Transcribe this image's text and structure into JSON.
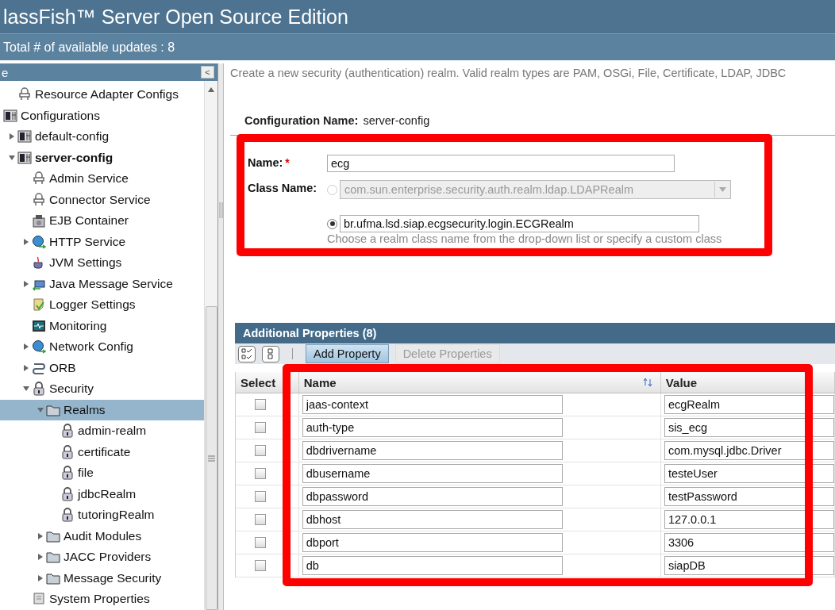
{
  "header": {
    "title": "lassFish™ Server Open Source Edition",
    "updates": "Total # of available updates : 8"
  },
  "sidebar": {
    "title": "e",
    "collapse": "<",
    "tree": [
      {
        "children": [
          {
            "label": "Resource Adapter Configs",
            "kind": "service"
          }
        ]
      },
      {
        "label": "Configurations",
        "kind": "config",
        "children": [
          {
            "label": "default-config",
            "kind": "config",
            "expanded": false
          },
          {
            "label": "server-config",
            "kind": "config",
            "expanded": true,
            "bold": true,
            "children": [
              {
                "label": "Admin Service",
                "kind": "service"
              },
              {
                "label": "Connector Service",
                "kind": "service"
              },
              {
                "label": "EJB Container",
                "kind": "container"
              },
              {
                "label": "HTTP Service",
                "kind": "network",
                "expanded": false
              },
              {
                "label": "JVM Settings",
                "kind": "jvm"
              },
              {
                "label": "Java Message Service",
                "kind": "messaging",
                "expanded": false
              },
              {
                "label": "Logger Settings",
                "kind": "logger"
              },
              {
                "label": "Monitoring",
                "kind": "monitor"
              },
              {
                "label": "Network Config",
                "kind": "network",
                "expanded": false
              },
              {
                "label": "ORB",
                "kind": "orb",
                "expanded": false
              },
              {
                "label": "Security",
                "kind": "lock",
                "expanded": true,
                "children": [
                  {
                    "label": "Realms",
                    "kind": "folder",
                    "expanded": true,
                    "selected": true,
                    "children": [
                      {
                        "label": "admin-realm",
                        "kind": "lock",
                        "selected": false
                      },
                      {
                        "label": "certificate",
                        "kind": "lock",
                        "selected": false
                      },
                      {
                        "label": "file",
                        "kind": "lock",
                        "selected": false
                      },
                      {
                        "label": "jdbcRealm",
                        "kind": "lock",
                        "selected": false
                      },
                      {
                        "label": "tutoringRealm",
                        "kind": "lock",
                        "selected": false
                      }
                    ]
                  },
                  {
                    "label": "Audit Modules",
                    "kind": "folder",
                    "expanded": false,
                    "selected": false
                  },
                  {
                    "label": "JACC Providers",
                    "kind": "folder",
                    "expanded": false,
                    "selected": false
                  },
                  {
                    "label": "Message Security",
                    "kind": "folder",
                    "expanded": false,
                    "selected": false
                  }
                ]
              },
              {
                "label": "System Properties",
                "kind": "properties"
              }
            ]
          }
        ]
      }
    ]
  },
  "content": {
    "description": "Create a new security (authentication) realm. Valid realm types are PAM, OSGi, File, Certificate, LDAP, JDBC",
    "config_label": "Configuration Name:",
    "config_value": "server-config",
    "form": {
      "highlighted": true,
      "name_label": "Name:",
      "required_mark": "*",
      "name_value": "ecg",
      "class_label": "Class Name:",
      "class_options": [
        {
          "kind": "select",
          "value": "com.sun.enterprise.security.auth.realm.ldap.LDAPRealm",
          "selected": false
        },
        {
          "kind": "text",
          "value": "br.ufma.lsd.siap.ecgsecurity.login.ECGRealm",
          "selected": true
        }
      ],
      "help": "Choose a realm class name from the drop-down list or specify a custom class"
    },
    "properties": {
      "title": "Additional Properties (8)",
      "highlighted": true,
      "buttons": [
        {
          "label": "Add Property",
          "disabled": false
        },
        {
          "label": "Delete Properties",
          "disabled": true
        }
      ],
      "columns": [
        "Select",
        "Name",
        "Value"
      ],
      "rows": [
        {
          "checked": false,
          "name": "jaas-context",
          "value": "ecgRealm"
        },
        {
          "checked": false,
          "name": "auth-type",
          "value": "sis_ecg"
        },
        {
          "checked": false,
          "name": "dbdrivername",
          "value": "com.mysql.jdbc.Driver"
        },
        {
          "checked": false,
          "name": "dbusername",
          "value": "testeUser"
        },
        {
          "checked": false,
          "name": "dbpassword",
          "value": "testPassword"
        },
        {
          "checked": false,
          "name": "dbhost",
          "value": "127.0.0.1"
        },
        {
          "checked": false,
          "name": "dbport",
          "value": "3306"
        },
        {
          "checked": false,
          "name": "db",
          "value": "siapDB"
        }
      ]
    }
  }
}
